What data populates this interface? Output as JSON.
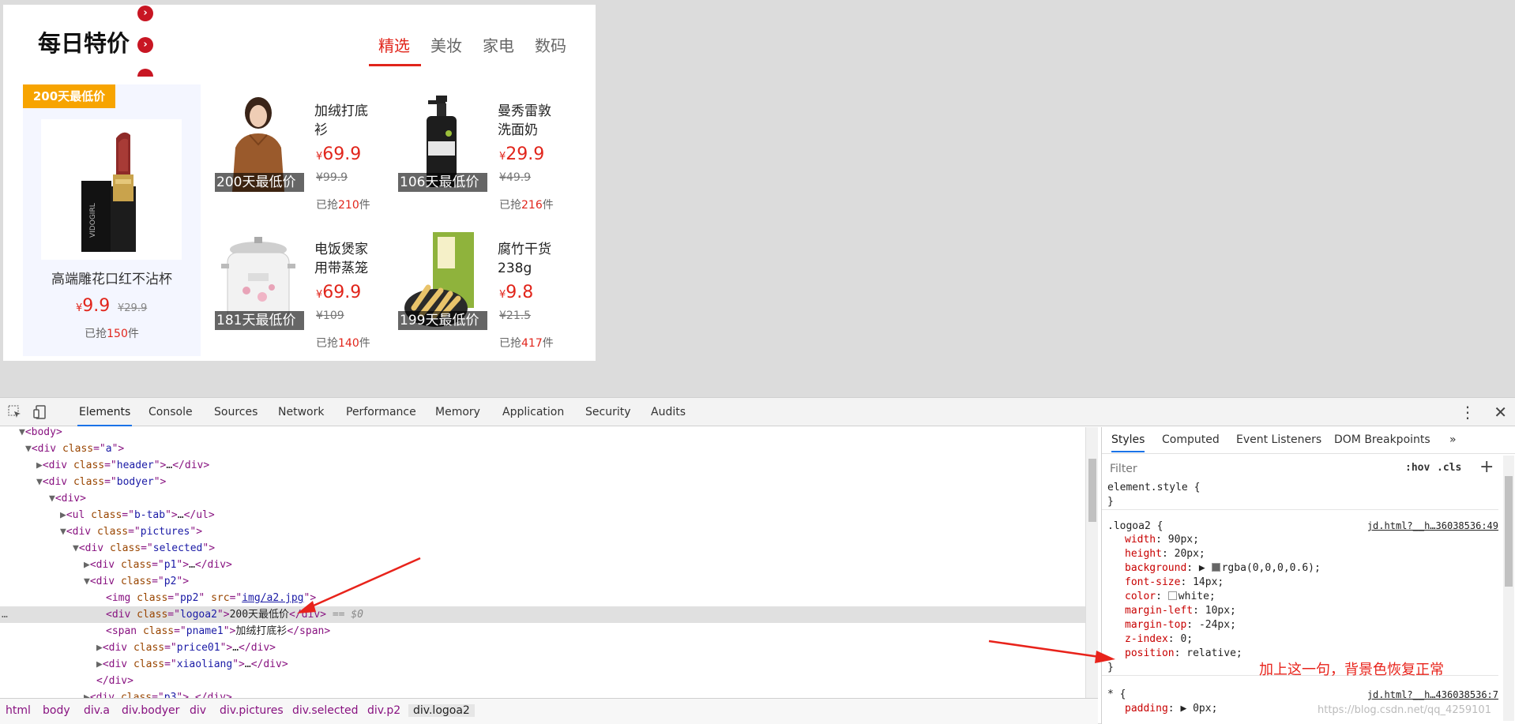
{
  "page": {
    "title": "每日特价",
    "tabs": [
      "精选",
      "美妆",
      "家电",
      "数码"
    ],
    "active_tab": "精选",
    "featured": {
      "badge": "200天最低价",
      "name": "高端雕花口红不沾杯",
      "currency": "¥",
      "price": "9.9",
      "old_price": "¥29.9",
      "sold_prefix": "已抢",
      "sold_count": "150",
      "sold_suffix": "件"
    },
    "products": [
      {
        "name": "加绒打底衫",
        "currency": "¥",
        "price": "69.9",
        "old_price": "¥99.9",
        "badge": "200天最低价",
        "sold_prefix": "已抢",
        "sold_count": "210",
        "sold_suffix": "件"
      },
      {
        "name": "曼秀雷敦洗面奶",
        "currency": "¥",
        "price": "29.9",
        "old_price": "¥49.9",
        "badge": "106天最低价",
        "sold_prefix": "已抢",
        "sold_count": "216",
        "sold_suffix": "件"
      },
      {
        "name": "电饭煲家用带蒸笼",
        "currency": "¥",
        "price": "69.9",
        "old_price": "¥109",
        "badge": "181天最低价",
        "sold_prefix": "已抢",
        "sold_count": "140",
        "sold_suffix": "件"
      },
      {
        "name": "腐竹干货238g",
        "currency": "¥",
        "price": "9.8",
        "old_price": "¥21.5",
        "badge": "199天最低价",
        "sold_prefix": "已抢",
        "sold_count": "417",
        "sold_suffix": "件"
      }
    ],
    "nav_arrow": "›"
  },
  "devtools": {
    "tabs": [
      "Elements",
      "Console",
      "Sources",
      "Network",
      "Performance",
      "Memory",
      "Application",
      "Security",
      "Audits"
    ],
    "active_tab": "Elements",
    "dom": {
      "l0": "<body>",
      "l1_tag": "div",
      "l1_class": "a",
      "l2_class": "header",
      "l3_class": "bodyer",
      "l5_class": "b-tab",
      "l6_class": "pictures",
      "l7_class": "selected",
      "l8_class": "p1",
      "l9_class": "p2",
      "l10_class": "pp2",
      "l10_src": "img/a2.jpg",
      "l11_class": "logoa2",
      "l11_text": "200天最低价",
      "l11_marker": "== $0",
      "l12_class": "pname1",
      "l12_text": "加绒打底衫",
      "l13_class": "price01",
      "l14_class": "xiaoliang",
      "l16_class": "p3",
      "ellipsis": "…"
    },
    "breadcrumb": [
      "html",
      "body",
      "div.a",
      "div.bodyer",
      "div",
      "div.pictures",
      "div.selected",
      "div.p2",
      "div.logoa2"
    ],
    "styles_tabs": [
      "Styles",
      "Computed",
      "Event Listeners",
      "DOM Breakpoints"
    ],
    "more_tabs": "»",
    "filter_placeholder": "Filter",
    "hov": ":hov",
    "cls": ".cls",
    "plus": "+",
    "element_style": "element.style {",
    "close_brace": "}",
    "rule1": {
      "selector": ".logoa2 {",
      "source": "jd.html?__h…36038536:49",
      "props": [
        {
          "name": "width",
          "value": "90px;"
        },
        {
          "name": "height",
          "value": "20px;"
        },
        {
          "name": "background",
          "value": "rgba(0,0,0,0.6);"
        },
        {
          "name": "font-size",
          "value": "14px;"
        },
        {
          "name": "color",
          "value": "white;"
        },
        {
          "name": "margin-left",
          "value": "10px;"
        },
        {
          "name": "margin-top",
          "value": "-24px;"
        },
        {
          "name": "z-index",
          "value": "0;"
        },
        {
          "name": "position",
          "value": "relative;"
        }
      ]
    },
    "rule2": {
      "selector": "* {",
      "source": "jd.html?__h…436038536:7",
      "props": [
        {
          "name": "padding",
          "value": "0px;"
        }
      ]
    },
    "annotation": "加上这一句，背景色恢复正常",
    "watermark": "https://blog.csdn.net/qq_4259101"
  },
  "colors": {
    "accent_red": "#e1251b",
    "badge_orange": "#f7a400",
    "annotation_red": "#e8231b"
  }
}
